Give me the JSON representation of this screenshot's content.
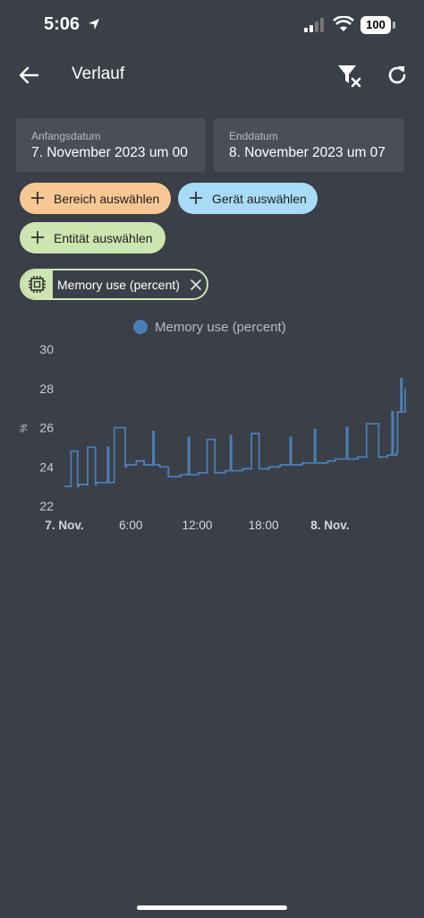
{
  "status": {
    "time": "5:06",
    "battery": "100"
  },
  "app_bar": {
    "title": "Verlauf"
  },
  "dates": {
    "start_label": "Anfangsdatum",
    "start_value": "7. November 2023 um 00",
    "end_label": "Enddatum",
    "end_value": "8. November 2023 um 07"
  },
  "targets": {
    "area_label": "Bereich auswählen",
    "device_label": "Gerät auswählen",
    "entity_label": "Entität auswählen"
  },
  "selected_entity": {
    "label": "Memory use (percent)",
    "icon": "chip-icon"
  },
  "colors": {
    "background": "#3b3f47",
    "area": "#f8c894",
    "device": "#a8dcf6",
    "entity": "#cde5b0",
    "series": "#4a7fb5"
  },
  "chart_data": {
    "type": "line",
    "title": "",
    "xlabel": "",
    "ylabel": "%",
    "ylim": [
      22,
      30
    ],
    "yticks": [
      22,
      24,
      26,
      28,
      30
    ],
    "xticks": [
      {
        "label": "7. Nov.",
        "hour": 0,
        "bold": true
      },
      {
        "label": "6:00",
        "hour": 6,
        "bold": false
      },
      {
        "label": "12:00",
        "hour": 12,
        "bold": false
      },
      {
        "label": "18:00",
        "hour": 18,
        "bold": false
      },
      {
        "label": "8. Nov.",
        "hour": 24,
        "bold": true
      }
    ],
    "legend": "top-center",
    "series": [
      {
        "name": "Memory use (percent)",
        "x": [
          0,
          0.5,
          0.6,
          1.2,
          1.3,
          2.0,
          2.1,
          2.8,
          2.9,
          3.5,
          3.7,
          3.9,
          4.0,
          4.4,
          4.5,
          5.5,
          5.6,
          6.4,
          6.5,
          7.2,
          7.3,
          8.0,
          8.1,
          8.5,
          8.6,
          9.4,
          9.5,
          10.5,
          10.6,
          11.2,
          11.3,
          12.0,
          12.1,
          12.8,
          12.9,
          13.6,
          13.7,
          14.5,
          14.6,
          15.0,
          15.1,
          16.0,
          16.1,
          16.8,
          16.9,
          17.6,
          17.7,
          18.5,
          18.6,
          19.5,
          19.6,
          20.4,
          20.5,
          21.5,
          21.6,
          22.6,
          22.7,
          23.8,
          23.9,
          24.5,
          24.6,
          25.5,
          25.6,
          26.5,
          26.6,
          27.2,
          27.3,
          28.4,
          28.5,
          29.2,
          29.3,
          29.6,
          29.7,
          30.0,
          30.1,
          30.4,
          30.5,
          30.8
        ],
        "y": [
          23.0,
          23.0,
          24.8,
          23.0,
          23.1,
          23.1,
          25.0,
          23.1,
          23.2,
          23.2,
          23.2,
          25.0,
          23.2,
          23.2,
          26.0,
          24.0,
          24.1,
          24.1,
          24.3,
          24.1,
          24.1,
          25.8,
          24.1,
          24.1,
          24.0,
          23.5,
          23.5,
          23.6,
          23.6,
          25.5,
          23.6,
          23.6,
          23.7,
          23.7,
          25.4,
          23.7,
          23.7,
          23.8,
          23.8,
          25.6,
          23.8,
          23.8,
          23.9,
          23.9,
          25.7,
          23.9,
          23.9,
          24.0,
          24.0,
          24.1,
          24.1,
          25.5,
          24.1,
          24.2,
          24.2,
          25.9,
          24.2,
          24.3,
          24.3,
          24.4,
          24.4,
          26.0,
          24.4,
          24.5,
          24.5,
          24.5,
          26.2,
          24.5,
          24.5,
          24.6,
          24.6,
          26.8,
          24.6,
          24.7,
          26.8,
          28.5,
          26.8,
          28.0
        ]
      }
    ]
  }
}
